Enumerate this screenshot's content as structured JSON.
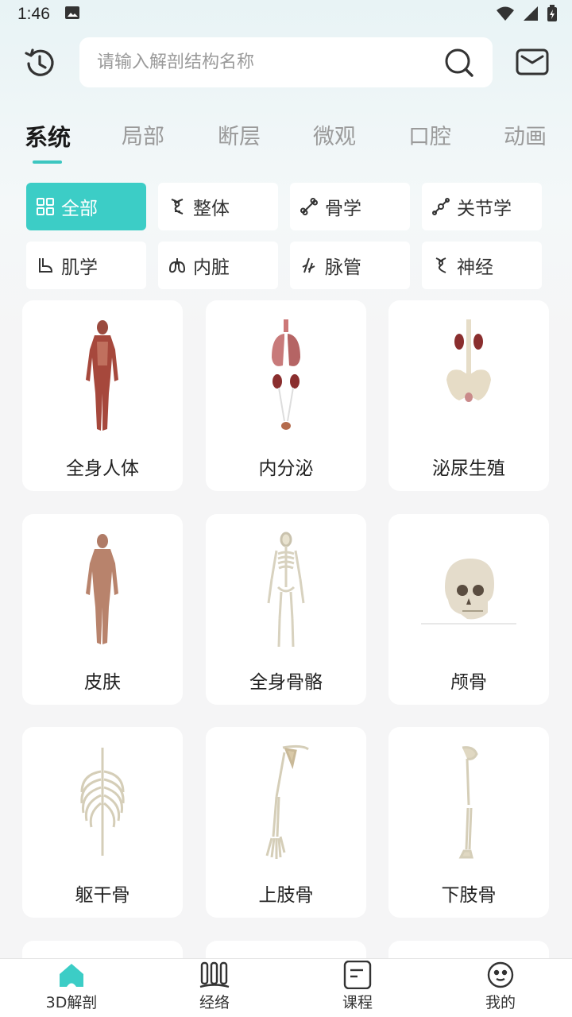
{
  "status": {
    "time": "1:46"
  },
  "search": {
    "placeholder": "请输入解剖结构名称"
  },
  "tabs": [
    {
      "label": "系统"
    },
    {
      "label": "局部"
    },
    {
      "label": "断层"
    },
    {
      "label": "微观"
    },
    {
      "label": "口腔"
    },
    {
      "label": "动画"
    }
  ],
  "filters": [
    {
      "label": "全部",
      "icon": "grid-icon"
    },
    {
      "label": "整体",
      "icon": "dna-icon"
    },
    {
      "label": "骨学",
      "icon": "bone-icon"
    },
    {
      "label": "关节学",
      "icon": "joint-icon"
    },
    {
      "label": "肌学",
      "icon": "muscle-icon"
    },
    {
      "label": "内脏",
      "icon": "lungs-icon"
    },
    {
      "label": "脉管",
      "icon": "vessel-icon"
    },
    {
      "label": "神经",
      "icon": "nerve-icon"
    }
  ],
  "cards": [
    {
      "label": "全身人体"
    },
    {
      "label": "内分泌"
    },
    {
      "label": "泌尿生殖"
    },
    {
      "label": "皮肤"
    },
    {
      "label": "全身骨骼"
    },
    {
      "label": "颅骨"
    },
    {
      "label": "躯干骨"
    },
    {
      "label": "上肢骨"
    },
    {
      "label": "下肢骨"
    }
  ],
  "nav": [
    {
      "label": "3D解剖"
    },
    {
      "label": "经络"
    },
    {
      "label": "课程"
    },
    {
      "label": "我的"
    }
  ],
  "colors": {
    "accent": "#3ccdc6"
  }
}
